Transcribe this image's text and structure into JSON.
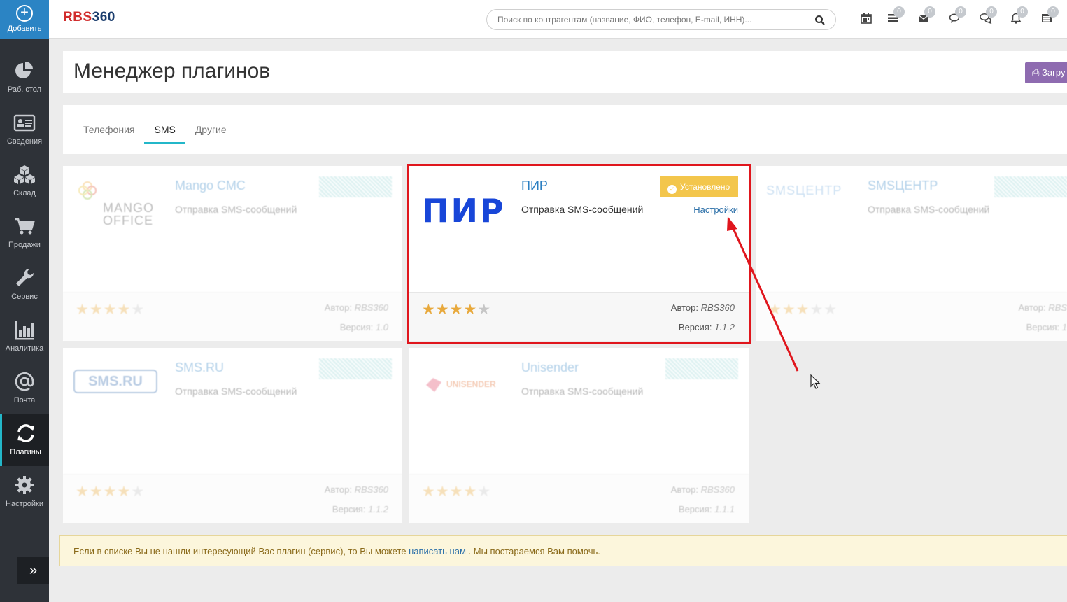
{
  "sidebar": {
    "add_label": "Добавить",
    "items": [
      {
        "label": "Раб. стол",
        "icon": "pie-chart-icon"
      },
      {
        "label": "Сведения",
        "icon": "id-card-icon"
      },
      {
        "label": "Склад",
        "icon": "boxes-icon"
      },
      {
        "label": "Продажи",
        "icon": "cart-icon"
      },
      {
        "label": "Сервис",
        "icon": "wrench-icon"
      },
      {
        "label": "Аналитика",
        "icon": "bar-chart-icon"
      },
      {
        "label": "Почта",
        "icon": "at-sign-icon"
      },
      {
        "label": "Плагины",
        "icon": "refresh-icon",
        "active": true
      },
      {
        "label": "Настройки",
        "icon": "gear-icon"
      }
    ],
    "collapse_icon": "double-chevron-right-icon"
  },
  "topbar": {
    "logo_text": "RBS",
    "logo_number": "360",
    "search_placeholder": "Поиск по контрагентам (название, ФИО, телефон, E-mail, ИНН)...",
    "badges": [
      "0",
      "0",
      "0",
      "0",
      "0",
      "0"
    ]
  },
  "page": {
    "title": "Менеджер плагинов",
    "upload_label": "Загру"
  },
  "tabs": [
    {
      "label": "Телефония"
    },
    {
      "label": "SMS",
      "active": true
    },
    {
      "label": "Другие"
    }
  ],
  "plugins": [
    {
      "name": "Mango СМС",
      "logo_text": "MANGO OFFICE",
      "desc": "Отправка SMS-сообщений",
      "stars": 4,
      "author_label": "Автор:",
      "author": "RBS360",
      "version_label": "Версия:",
      "version": "1.0",
      "installed": false
    },
    {
      "name": "ПИР",
      "logo_text": "ПИР",
      "desc": "Отправка SMS-сообщений",
      "stars": 4,
      "author_label": "Автор:",
      "author": "RBS360",
      "version_label": "Версия:",
      "version": "1.1.2",
      "installed": true,
      "installed_label": "Установлено",
      "settings_label": "Настройки"
    },
    {
      "name": "SMSЦЕНТР",
      "logo_text": "SMSЦЕНТР",
      "desc": "Отправка SMS-сообщений",
      "stars": 3,
      "author_label": "Автор:",
      "author": "RBS",
      "version_label": "Версия:",
      "version": "1",
      "installed": false
    },
    {
      "name": "SMS.RU",
      "logo_text": "SMS.RU",
      "desc": "Отправка SMS-сообщений",
      "stars": 4,
      "author_label": "Автор:",
      "author": "RBS360",
      "version_label": "Версия:",
      "version": "1.1.2",
      "installed": false
    },
    {
      "name": "Unisender",
      "logo_text": "UNISENDER",
      "desc": "Отправка SMS-сообщений",
      "stars": 4,
      "author_label": "Автор:",
      "author": "RBS360",
      "version_label": "Версия:",
      "version": "1.1.1",
      "installed": false
    }
  ],
  "info": {
    "text_before": "Если в списке Вы не нашли интересующий Вас плагин (сервис), то Вы можете ",
    "link": "написать нам",
    "text_after": " . Мы постараемся Вам помочь."
  },
  "colors": {
    "accent": "#23b7c9",
    "link": "#2b7fc2",
    "installed": "#f3c64c",
    "highlight": "#e0161d",
    "sidebar": "#2e3238"
  }
}
